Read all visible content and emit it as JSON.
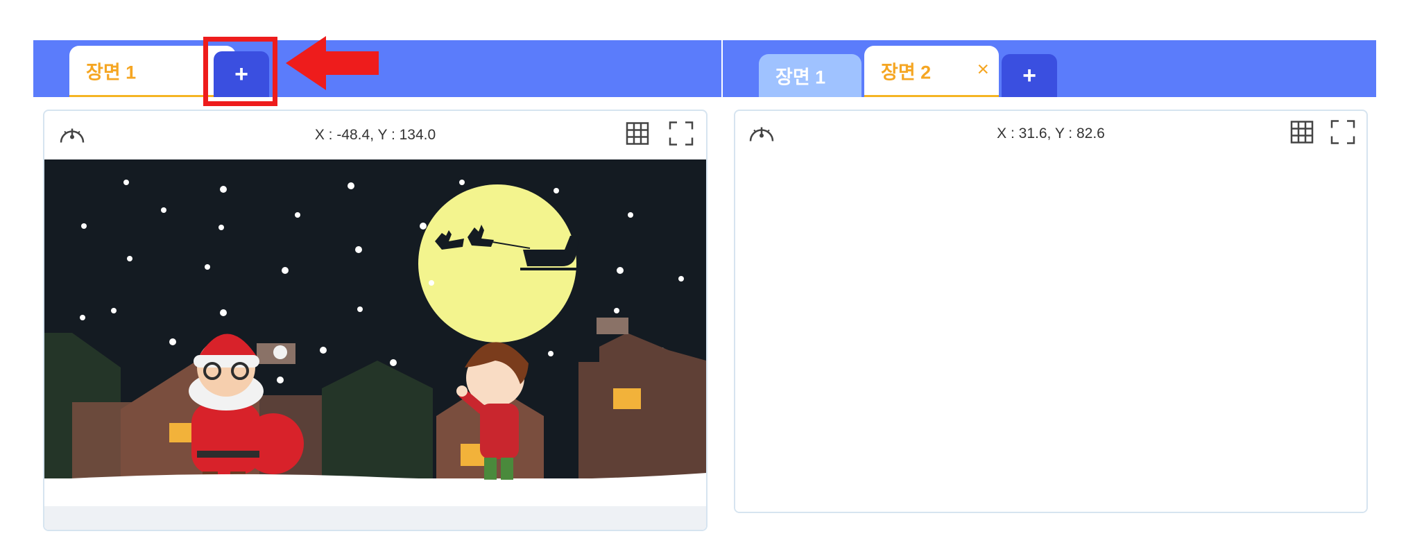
{
  "left": {
    "tabs": [
      {
        "label": "장면 1",
        "active": true,
        "close": "×"
      }
    ],
    "add_button": "+",
    "coords": "X : -48.4, Y : 134.0"
  },
  "right": {
    "tabs": [
      {
        "label": "장면 1",
        "active": false
      },
      {
        "label": "장면 2",
        "active": true,
        "close": "×"
      }
    ],
    "add_button": "+",
    "coords": "X : 31.6, Y : 82.6"
  },
  "icons": [
    "speed-gauge-icon",
    "grid-icon",
    "fullscreen-icon"
  ],
  "colors": {
    "tabbar": "#5b7cfb",
    "active_tab_text": "#f5a623",
    "add_button": "#3a4fe0",
    "highlight": "#ee1c1c",
    "night_sky": "#141b22",
    "moon": "#f3f48e"
  }
}
